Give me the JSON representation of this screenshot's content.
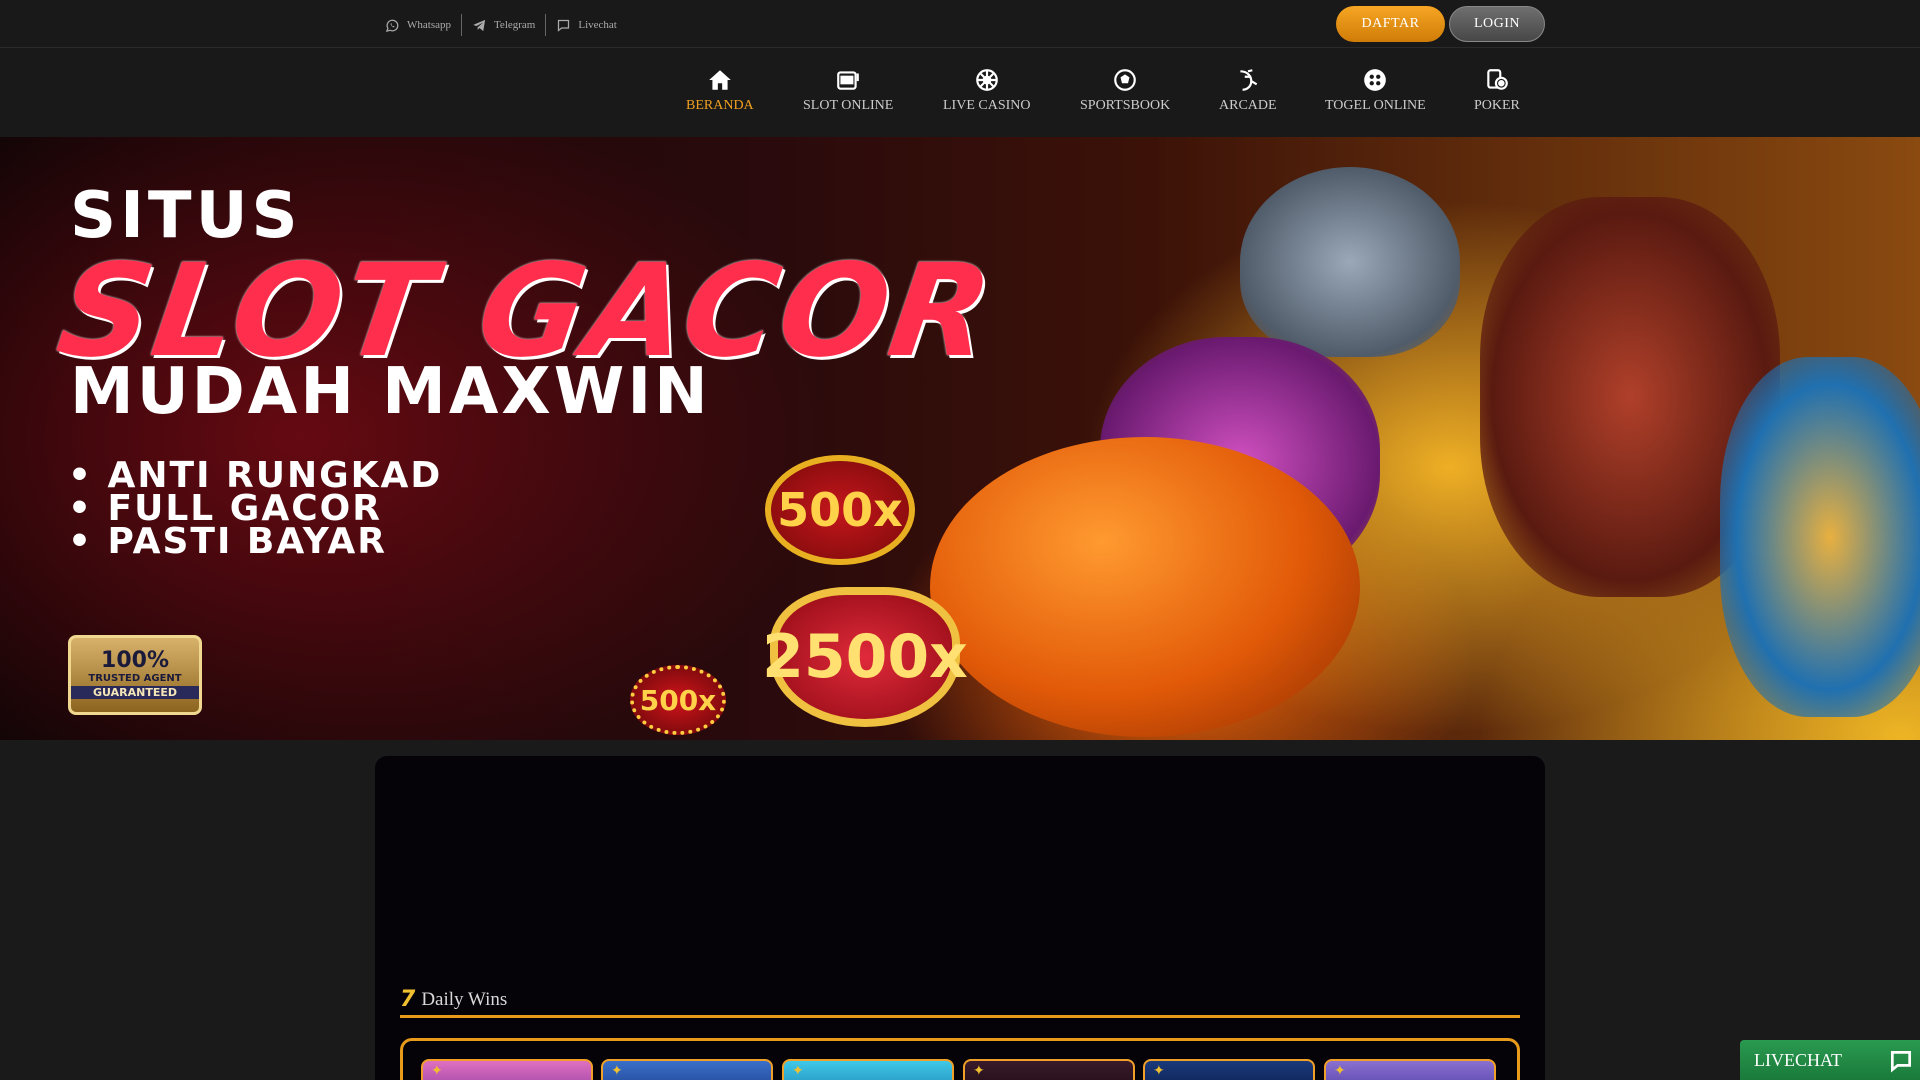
{
  "topbar": {
    "contacts": [
      {
        "label": "Whatsapp",
        "icon": "whatsapp-icon"
      },
      {
        "label": "Telegram",
        "icon": "telegram-icon"
      },
      {
        "label": "Livechat",
        "icon": "chat-icon"
      }
    ],
    "register_label": "DAFTAR",
    "login_label": "LOGIN"
  },
  "nav": {
    "items": [
      {
        "label": "BERANDA",
        "icon": "home-icon",
        "active": true
      },
      {
        "label": "SLOT ONLINE",
        "icon": "slot-machine-icon"
      },
      {
        "label": "LIVE CASINO",
        "icon": "roulette-icon"
      },
      {
        "label": "SPORTSBOOK",
        "icon": "soccer-ball-icon"
      },
      {
        "label": "ARCADE",
        "icon": "fish-icon"
      },
      {
        "label": "TOGEL ONLINE",
        "icon": "lottery-ball-icon"
      },
      {
        "label": "POKER",
        "icon": "poker-chip-icon"
      }
    ],
    "active_color": "#f0a020"
  },
  "banner": {
    "line1": "SITUS",
    "line2": "SLOT GACOR",
    "line3": "MUDAH MAXWIN",
    "bullets": [
      "ANTI RUNGKAD",
      "FULL GACOR",
      "PASTI BAYAR"
    ],
    "badge": {
      "percent": "100%",
      "line1": "TRUSTED AGENT",
      "line2": "GUARANTEED"
    },
    "medals": [
      "500x",
      "2500x",
      "500x"
    ]
  },
  "daily_wins": {
    "icon": "7",
    "title": "Daily Wins",
    "accent": "#e89a1a"
  },
  "livechat": {
    "label": "LIVECHAT",
    "color": "#2a9a50"
  }
}
